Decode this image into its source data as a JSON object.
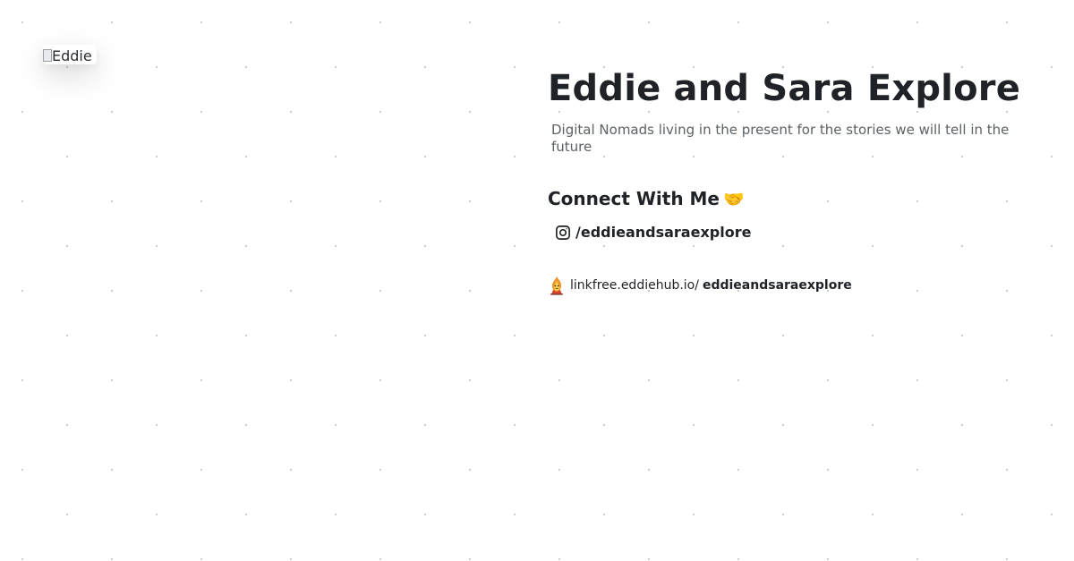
{
  "profile": {
    "avatar_alt": "Eddie",
    "name": "Eddie and Sara Explore",
    "bio": "Digital Nomads living in the present for the stories we will tell in the future"
  },
  "connect": {
    "heading": "Connect With Me",
    "emoji": "🤝"
  },
  "socials": [
    {
      "icon": "instagram-icon",
      "handle": "/eddieandsaraexplore"
    }
  ],
  "footer": {
    "icon": "linkfree-logo-icon",
    "domain": "linkfree.eddiehub.io/",
    "username": "eddieandsaraexplore"
  },
  "colors": {
    "text_primary": "#1f2226",
    "text_secondary": "#5c6166",
    "background": "#ffffff",
    "dot_grid": "#c4c7cc"
  }
}
